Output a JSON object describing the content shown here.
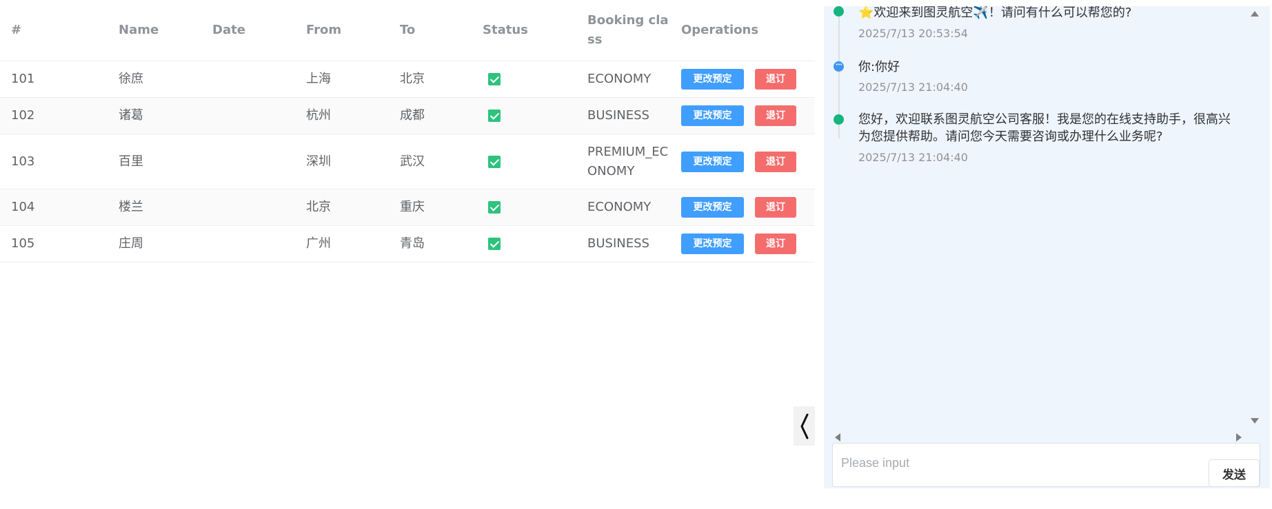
{
  "table": {
    "headers": {
      "num": "#",
      "name": "Name",
      "date": "Date",
      "from": "From",
      "to": "To",
      "status": "Status",
      "booking_class": "Booking class",
      "operations": "Operations"
    },
    "rows": [
      {
        "num": "101",
        "name": "徐庶",
        "date": "",
        "from": "上海",
        "to": "北京",
        "status": "checked",
        "booking_class": "ECONOMY",
        "change_label": "更改预定",
        "cancel_label": "退订"
      },
      {
        "num": "102",
        "name": "诸葛",
        "date": "",
        "from": "杭州",
        "to": "成都",
        "status": "checked",
        "booking_class": "BUSINESS",
        "change_label": "更改预定",
        "cancel_label": "退订"
      },
      {
        "num": "103",
        "name": "百里",
        "date": "",
        "from": "深圳",
        "to": "武汉",
        "status": "checked",
        "booking_class": "PREMIUM_ECONOMY",
        "change_label": "更改预定",
        "cancel_label": "退订"
      },
      {
        "num": "104",
        "name": "楼兰",
        "date": "",
        "from": "北京",
        "to": "重庆",
        "status": "checked",
        "booking_class": "ECONOMY",
        "change_label": "更改预定",
        "cancel_label": "退订"
      },
      {
        "num": "105",
        "name": "庄周",
        "date": "",
        "from": "广州",
        "to": "青岛",
        "status": "checked",
        "booking_class": "BUSINESS",
        "change_label": "更改预定",
        "cancel_label": "退订"
      }
    ]
  },
  "chat": {
    "messages": [
      {
        "sender": "assistant",
        "text": "⭐欢迎来到图灵航空✈️！请问有什么可以帮您的?",
        "time": "2025/7/13 20:53:54"
      },
      {
        "sender": "user",
        "text": "你:你好",
        "time": "2025/7/13 21:04:40"
      },
      {
        "sender": "assistant",
        "text": "您好，欢迎联系图灵航空公司客服！我是您的在线支持助手，很高兴为您提供帮助。请问您今天需要咨询或办理什么业务呢?",
        "time": "2025/7/13 21:04:40"
      }
    ],
    "input_placeholder": "Please input",
    "input_value": "",
    "send_label": "发送"
  },
  "icons": {
    "collapse": "chevron-left-icon",
    "status": "checkbox-checked-icon"
  },
  "colors": {
    "primary": "#409eff",
    "danger": "#f56c6c",
    "success": "#2fc27e",
    "chat_bg": "#eef5fd"
  }
}
